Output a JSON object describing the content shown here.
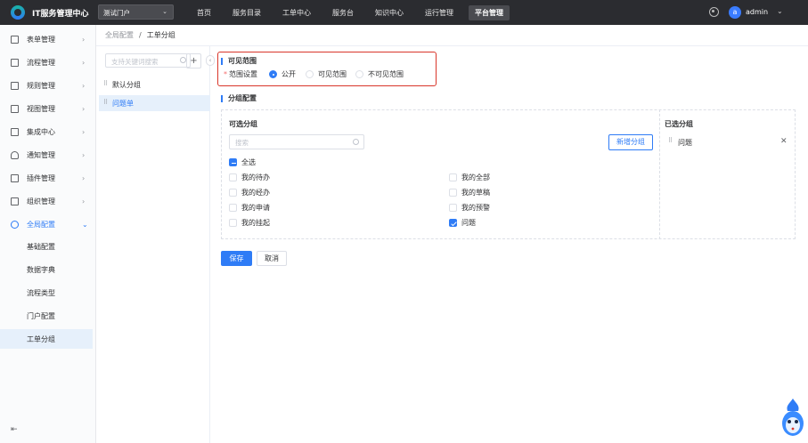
{
  "header": {
    "app_title": "IT服务管理中心",
    "portal_select": "测试门户",
    "nav": [
      "首页",
      "服务目录",
      "工单中心",
      "服务台",
      "知识中心",
      "运行管理",
      "平台管理"
    ],
    "nav_active_index": 6,
    "avatar_letter": "a",
    "username": "admin"
  },
  "sidebar": {
    "items": [
      {
        "label": "表单管理",
        "icon": "form-icon"
      },
      {
        "label": "流程管理",
        "icon": "flow-icon"
      },
      {
        "label": "规则管理",
        "icon": "rule-icon"
      },
      {
        "label": "视图管理",
        "icon": "view-icon"
      },
      {
        "label": "集成中心",
        "icon": "integration-icon"
      },
      {
        "label": "通知管理",
        "icon": "bell-icon"
      },
      {
        "label": "插件管理",
        "icon": "plugin-icon"
      },
      {
        "label": "组织管理",
        "icon": "org-icon"
      },
      {
        "label": "全局配置",
        "icon": "gear-icon"
      }
    ],
    "sub_items": [
      "基础配置",
      "数据字典",
      "流程类型",
      "门户配置",
      "工单分组"
    ],
    "active_sub": "工单分组"
  },
  "breadcrumb": {
    "parent": "全局配置",
    "separator": "/",
    "current": "工单分组"
  },
  "group_panel": {
    "search_placeholder": "支持关键词搜索",
    "add_label": "+",
    "groups": [
      "默认分组",
      "问题单"
    ],
    "active_group": "问题单"
  },
  "visible_range": {
    "title": "可见范围",
    "label": "范围设置",
    "required_mark": "*",
    "options": [
      "公开",
      "可见范围",
      "不可见范围"
    ],
    "selected": "公开"
  },
  "group_config": {
    "title": "分组配置",
    "available_title": "可选分组",
    "search_placeholder": "搜索",
    "new_group_label": "新增分组",
    "select_all_label": "全选",
    "left_column": [
      {
        "label": "我的待办",
        "checked": false
      },
      {
        "label": "我的经办",
        "checked": false
      },
      {
        "label": "我的申请",
        "checked": false
      },
      {
        "label": "我的挂起",
        "checked": false
      }
    ],
    "right_column": [
      {
        "label": "我的全部",
        "checked": false
      },
      {
        "label": "我的草稿",
        "checked": false
      },
      {
        "label": "我的预警",
        "checked": false
      },
      {
        "label": "问题",
        "checked": true
      }
    ],
    "selected_title": "已选分组",
    "selected_items": [
      "问题"
    ]
  },
  "actions": {
    "save_label": "保存",
    "cancel_label": "取消"
  },
  "colors": {
    "primary": "#2f7cf6",
    "header_bg": "#2b2c30",
    "highlight_border": "#d9362a"
  }
}
